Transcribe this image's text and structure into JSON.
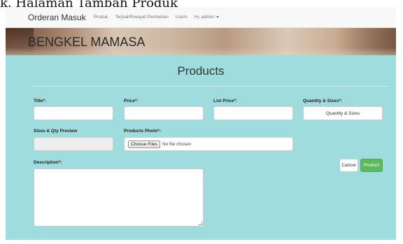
{
  "caption": "k. Halaman Tambah Produk",
  "navbar": {
    "brand": "Orderan Masuk",
    "links": [
      "Produk",
      "Terjual/Riwayat Pembelian",
      "Users"
    ],
    "user_label": "Hi, admin!"
  },
  "banner": {
    "title": "BENGKEL MAMASA"
  },
  "page": {
    "title": "Products"
  },
  "form": {
    "title_label": "Title*:",
    "title_value": "",
    "price_label": "Price*:",
    "price_value": "",
    "list_price_label": "List Price*:",
    "list_price_value": "",
    "quantity_label": "Quantity & Sizes*:",
    "quantity_button": "Quantity & Sizes",
    "sizes_preview_label": "Sizes & Qty Preview",
    "sizes_preview_value": "",
    "photo_label": "Products Photo*:",
    "choose_files": "Choose Files",
    "no_file": "No file chosen",
    "description_label": "Description*:",
    "description_value": "",
    "cancel": "Cancel",
    "submit": "Product"
  },
  "colors": {
    "background": "#9fdcde",
    "navbar": "#f8f8f8",
    "success": "#5cb85c"
  }
}
